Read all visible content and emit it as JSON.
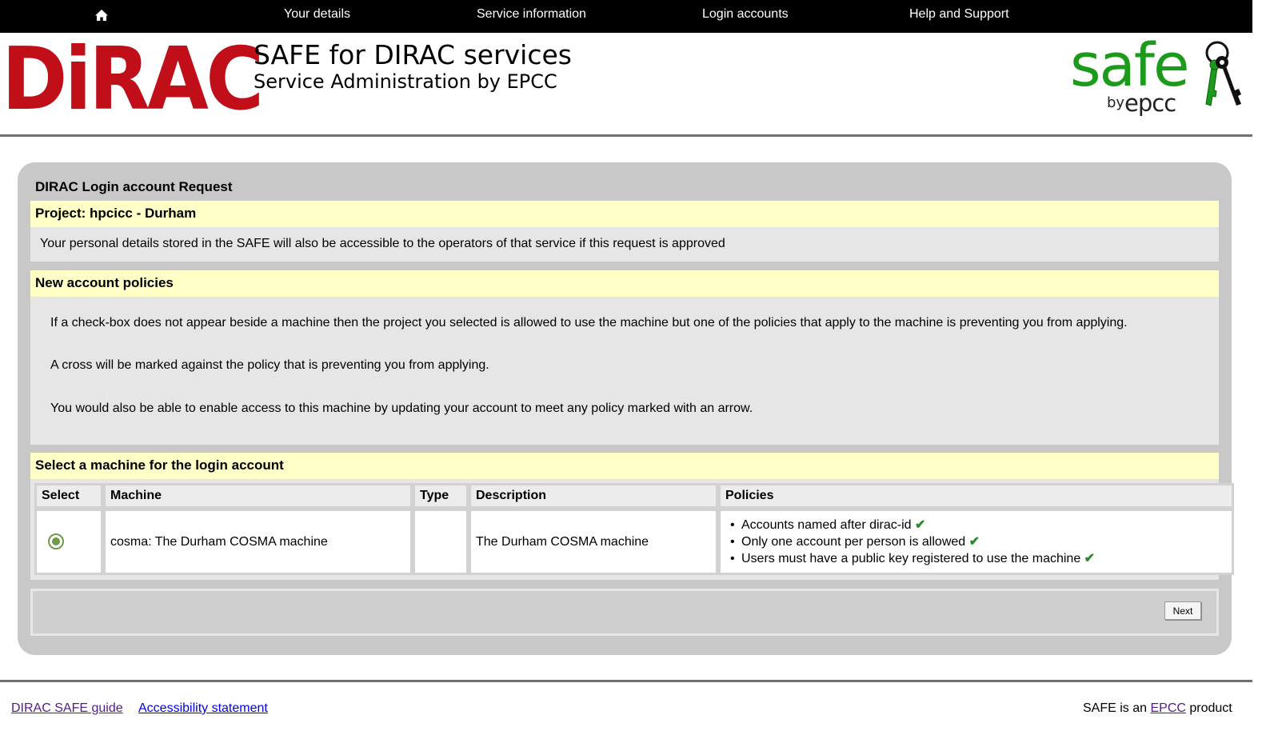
{
  "nav": {
    "home_icon": "home-icon",
    "items": [
      "Your details",
      "Service information",
      "Login accounts",
      "Help and Support"
    ]
  },
  "header": {
    "logo_text": "DiRAC",
    "title": "SAFE for DIRAC services",
    "subtitle": "Service Administration by EPCC",
    "safe_logo": {
      "word": "safe",
      "by": "by",
      "epcc": "epcc"
    }
  },
  "form": {
    "title": "DIRAC Login account Request",
    "project_heading": "Project: hpcicc - Durham",
    "project_note": "Your personal details stored in the SAFE will also be accessible to the operators of that service if this request is approved",
    "policies_heading": "New account policies",
    "policy_paragraphs": [
      "If a check-box does not appear beside a machine then the project you selected is allowed to use the machine but one of the policies that apply to the machine is preventing you from applying.",
      "A cross will be marked against the policy that is preventing you from applying.",
      "You would also be able to enable access to this machine by updating your account to meet any policy marked with an arrow."
    ],
    "machine_heading": "Select a machine for the login account",
    "table": {
      "headers": [
        "Select",
        "Machine",
        "Type",
        "Description",
        "Policies"
      ],
      "rows": [
        {
          "selected": true,
          "machine": "cosma: The Durham COSMA machine",
          "type": "",
          "description": "The Durham COSMA machine",
          "policies": [
            "Accounts named after dirac-id",
            "Only one account per person is allowed",
            "Users must have a public key registered to use the machine"
          ],
          "policy_mark": "✔"
        }
      ]
    },
    "next_label": "Next"
  },
  "footer": {
    "links": [
      "DIRAC SAFE guide",
      "Accessibility statement"
    ],
    "right_prefix": "SAFE is an ",
    "right_link": "EPCC",
    "right_suffix": " product"
  },
  "colors": {
    "nav_bg": "#000000",
    "dirac_red": "#c10f1a",
    "safe_green": "#1b9a1b",
    "section_heading_bg": "#ffffc8",
    "section_body_bg": "#e6e6e6",
    "panel_bg": "#c8c8c8",
    "tick_green": "#2a8a2a"
  }
}
